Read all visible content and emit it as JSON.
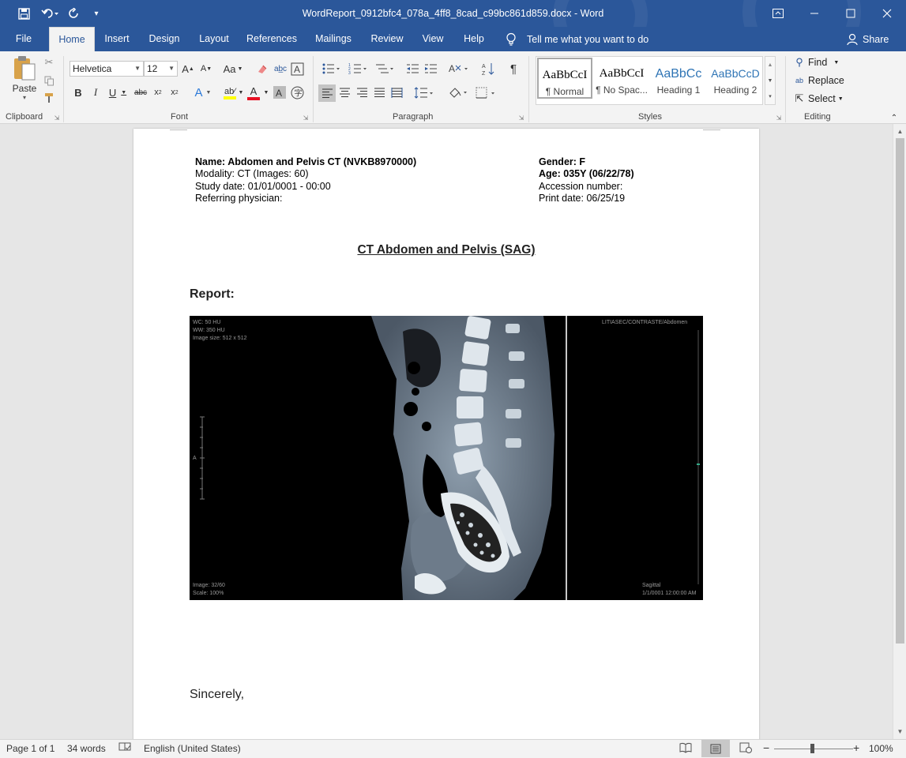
{
  "titlebar": {
    "title": "WordReport_0912bfc4_078a_4ff8_8cad_c99bc861d859.docx  -  Word"
  },
  "tabs": [
    {
      "label": "File"
    },
    {
      "label": "Home"
    },
    {
      "label": "Insert"
    },
    {
      "label": "Design"
    },
    {
      "label": "Layout"
    },
    {
      "label": "References"
    },
    {
      "label": "Mailings"
    },
    {
      "label": "Review"
    },
    {
      "label": "View"
    },
    {
      "label": "Help"
    }
  ],
  "tell_me": "Tell me what you want to do",
  "share_label": "Share",
  "ribbon": {
    "clipboard": {
      "paste_label": "Paste",
      "group_label": "Clipboard"
    },
    "font": {
      "font_name": "Helvetica",
      "font_size": "12",
      "group_label": "Font",
      "change_case": "Aa"
    },
    "paragraph": {
      "group_label": "Paragraph"
    },
    "styles": {
      "group_label": "Styles",
      "items": [
        {
          "sample": "AaBbCcI",
          "name": "¶ Normal"
        },
        {
          "sample": "AaBbCcI",
          "name": "¶ No Spac..."
        },
        {
          "sample": "AaBbCc",
          "name": "Heading 1"
        },
        {
          "sample": "AaBbCcD",
          "name": "Heading 2"
        }
      ]
    },
    "editing": {
      "group_label": "Editing",
      "find": "Find",
      "replace": "Replace",
      "select": "Select"
    }
  },
  "document": {
    "left_header": [
      {
        "label": "Name: Abdomen and Pelvis CT (NVKB8970000)"
      },
      {
        "label": "Modality: CT (Images: 60)"
      },
      {
        "label": "Study date: 01/01/0001 - 00:00"
      },
      {
        "label": "Referring physician:"
      }
    ],
    "right_header": [
      {
        "label": "Gender: F"
      },
      {
        "label": "Age: 035Y (06/22/78)"
      },
      {
        "label": "Accession number:"
      },
      {
        "label": "Print date: 06/25/19"
      }
    ],
    "title": "CT Abdomen and Pelvis (SAG)",
    "report_label": "Report:",
    "ct_overlay": {
      "top_left": [
        "WC: 50 HU",
        "WW: 350 HU",
        "Image size: 512 x 512"
      ],
      "top_right": "LITIASEC/CONTRASTE/Abdomen",
      "bottom_left": [
        "Image: 32/60",
        "Scale: 100%"
      ],
      "bottom_right": [
        "Sagittal",
        "1/1/0001 12:00:00 AM"
      ],
      "side_marker": "A"
    },
    "closing": "Sincerely,"
  },
  "status": {
    "page": "Page 1 of 1",
    "words": "34 words",
    "language": "English (United States)",
    "zoom": "100%"
  },
  "colors": {
    "accent": "#2b579a",
    "ribbon": "#f3f3f3",
    "font_color_bar": "#e81123",
    "highlight_bar": "#ffff00"
  }
}
